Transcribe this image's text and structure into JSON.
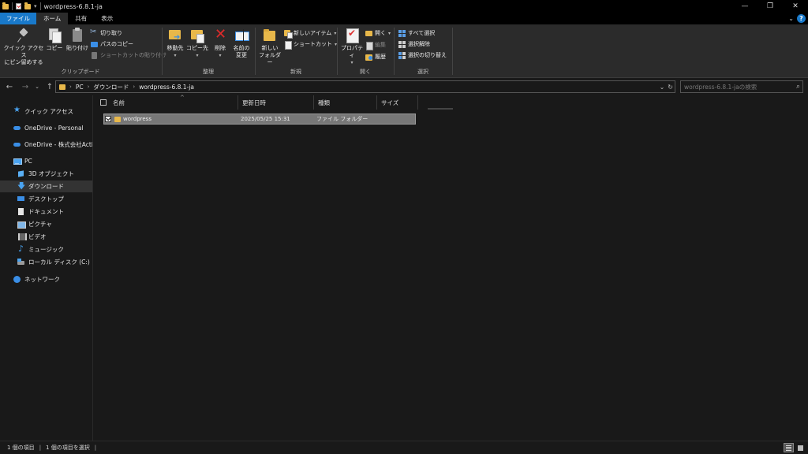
{
  "window": {
    "title": "wordpress-6.8.1-ja",
    "controls": {
      "minimize": "—",
      "maximize": "❐",
      "close": "✕"
    }
  },
  "ribbon_tabs": [
    {
      "label": "ファイル"
    },
    {
      "label": "ホーム"
    },
    {
      "label": "共有"
    },
    {
      "label": "表示"
    }
  ],
  "help": {
    "collapse": "⌄",
    "help": "?"
  },
  "ribbon": {
    "clipboard": {
      "label": "クリップボード",
      "pin_label_1": "クイック アクセス",
      "pin_label_2": "にピン留めする",
      "copy": "コピー",
      "paste": "貼り付け",
      "cut": "切り取り",
      "copy_path": "パスのコピー",
      "paste_shortcut": "ショートカットの貼り付け"
    },
    "organize": {
      "label": "整理",
      "move_to": "移動先",
      "copy_to": "コピー先",
      "delete": "削除",
      "rename_1": "名前の",
      "rename_2": "変更"
    },
    "new": {
      "label": "新規",
      "new_folder_1": "新しい",
      "new_folder_2": "フォルダー",
      "new_item": "新しいアイテム",
      "shortcut": "ショートカット"
    },
    "open": {
      "label": "開く",
      "properties": "プロパティ",
      "open": "開く",
      "edit": "編集",
      "history": "履歴"
    },
    "select": {
      "label": "選択",
      "select_all": "すべて選択",
      "select_none": "選択解除",
      "invert": "選択の切り替え"
    }
  },
  "address": {
    "crumbs": [
      "PC",
      "ダウンロード",
      "wordpress-6.8.1-ja"
    ],
    "dropdown": "⌄",
    "refresh": "↻"
  },
  "search": {
    "placeholder": "wordpress-6.8.1-jaの検索"
  },
  "sidebar": {
    "items": [
      {
        "label": "クイック アクセス",
        "icon": "star-icon"
      },
      {
        "label": "OneDrive - Personal",
        "icon": "cloud-icon"
      },
      {
        "label": "OneDrive - 株式会社Actio",
        "icon": "cloud-icon"
      },
      {
        "label": "PC",
        "icon": "pc-icon"
      },
      {
        "label": "3D オブジェクト",
        "icon": "cube-icon"
      },
      {
        "label": "ダウンロード",
        "icon": "download-icon"
      },
      {
        "label": "デスクトップ",
        "icon": "desktop-icon"
      },
      {
        "label": "ドキュメント",
        "icon": "document-icon"
      },
      {
        "label": "ピクチャ",
        "icon": "picture-icon"
      },
      {
        "label": "ビデオ",
        "icon": "video-icon"
      },
      {
        "label": "ミュージック",
        "icon": "music-icon"
      },
      {
        "label": "ローカル ディスク (C:)",
        "icon": "disk-icon"
      },
      {
        "label": "ネットワーク",
        "icon": "network-icon"
      }
    ]
  },
  "columns": {
    "name": "名前",
    "modified": "更新日時",
    "type": "種類",
    "size": "サイズ"
  },
  "files": [
    {
      "name": "wordpress",
      "modified": "2025/05/25 15:31",
      "type": "ファイル フォルダー",
      "size": ""
    }
  ],
  "status": {
    "count": "1 個の項目",
    "selected": "1 個の項目を選択",
    "sep": "|"
  }
}
